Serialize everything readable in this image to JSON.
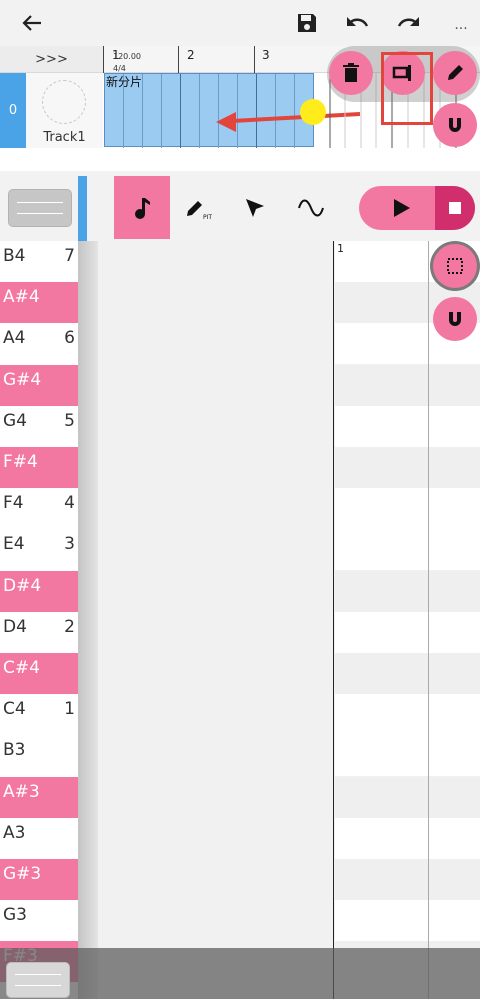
{
  "header": {
    "back_icon": "arrow-left-icon",
    "save_icon": "save-icon",
    "undo_icon": "undo-icon",
    "redo_icon": "redo-icon",
    "more_label": "..."
  },
  "timeline": {
    "expand_label": ">>>",
    "bars": [
      "1",
      "2",
      "3"
    ],
    "tempo": "120.00",
    "time_signature": "4/4"
  },
  "track": {
    "index": "0",
    "name": "Track1",
    "clip_name": "新分片"
  },
  "toolbar": {
    "tools": [
      "note-icon",
      "pencil-pit-icon",
      "cursor-icon",
      "wave-icon"
    ],
    "active_tool": "note-icon",
    "pencil_sub": "PIT",
    "play_icon": "play-icon",
    "stop_icon": "stop-icon"
  },
  "clip_actions": {
    "delete_icon": "trash-icon",
    "split_icon": "split-clip-icon",
    "edit_icon": "pencil-icon",
    "snap_icon": "magnet-icon"
  },
  "piano_roll": {
    "bar_label": "1",
    "select_icon": "select-box-icon",
    "snap_icon": "magnet-icon",
    "keys": [
      {
        "name": "B4",
        "octave": "7",
        "black": false
      },
      {
        "name": "A#4",
        "octave": "",
        "black": true
      },
      {
        "name": "A4",
        "octave": "6",
        "black": false
      },
      {
        "name": "G#4",
        "octave": "",
        "black": true
      },
      {
        "name": "G4",
        "octave": "5",
        "black": false
      },
      {
        "name": "F#4",
        "octave": "",
        "black": true
      },
      {
        "name": "F4",
        "octave": "4",
        "black": false
      },
      {
        "name": "E4",
        "octave": "3",
        "black": false
      },
      {
        "name": "D#4",
        "octave": "",
        "black": true
      },
      {
        "name": "D4",
        "octave": "2",
        "black": false
      },
      {
        "name": "C#4",
        "octave": "",
        "black": true
      },
      {
        "name": "C4",
        "octave": "1",
        "black": false
      },
      {
        "name": "B3",
        "octave": "",
        "black": false
      },
      {
        "name": "A#3",
        "octave": "",
        "black": true
      },
      {
        "name": "A3",
        "octave": "",
        "black": false
      },
      {
        "name": "G#3",
        "octave": "",
        "black": true
      },
      {
        "name": "G3",
        "octave": "",
        "black": false
      },
      {
        "name": "F#3",
        "octave": "",
        "black": true
      }
    ]
  },
  "colors": {
    "accent_pink": "#f277a1",
    "stop_pink": "#d02e6c",
    "track_blue": "#4aa3e6",
    "clip_blue": "#9ccbf2",
    "annotation_red": "#e2453c",
    "pointer_yellow": "#ffec1a"
  }
}
